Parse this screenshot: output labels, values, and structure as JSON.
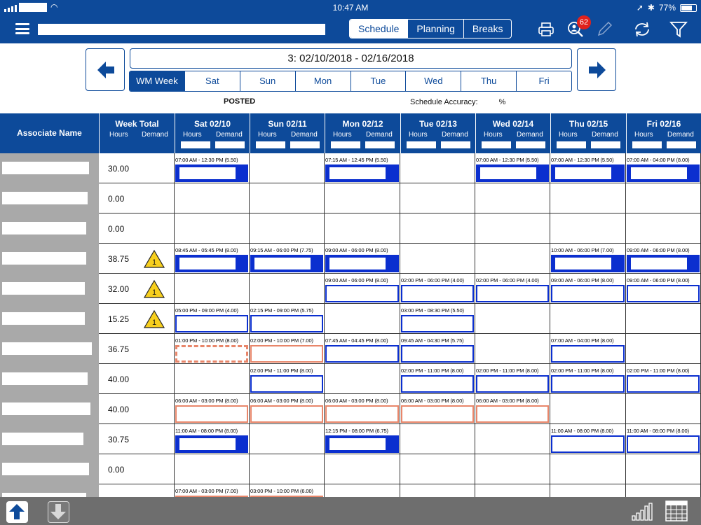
{
  "status": {
    "time": "10:47 AM",
    "battery": "77%",
    "battery_level": 0.77
  },
  "nav": {
    "tabs": [
      "Schedule",
      "Planning",
      "Breaks"
    ],
    "active_tab": "Schedule",
    "notification_count": "62",
    "icons": [
      "print-icon",
      "people-search-icon",
      "pencil-icon",
      "refresh-icon",
      "filter-icon"
    ]
  },
  "week": {
    "range": "3: 02/10/2018 - 02/16/2018",
    "day_tabs": [
      "WM Week",
      "Sat",
      "Sun",
      "Mon",
      "Tue",
      "Wed",
      "Thu",
      "Fri"
    ],
    "posted": "POSTED",
    "accuracy_label": "Schedule Accuracy:",
    "accuracy_unit": "%"
  },
  "grid": {
    "associate_header": "Associate Name",
    "week_total_header": "Week Total",
    "hours_label": "Hours",
    "demand_label": "Demand",
    "days": [
      "Sat 02/10",
      "Sun 02/11",
      "Mon 02/12",
      "Tue 02/13",
      "Wed 02/14",
      "Thu 02/15",
      "Fri 02/16"
    ],
    "rows": [
      {
        "hours": "30.00",
        "warn": false,
        "shifts": [
          "07:00 AM - 12:30 PM (5.50)",
          "",
          "07:15 AM - 12:45 PM (5.50)",
          "",
          "07:00 AM - 12:30 PM (5.50)",
          "07:00 AM - 12:30 PM (5.50)",
          "07:00 AM - 04:00 PM (8.00)"
        ]
      },
      {
        "hours": "0.00",
        "warn": false,
        "shifts": [
          "",
          "",
          "",
          "",
          "",
          "",
          ""
        ]
      },
      {
        "hours": "0.00",
        "warn": false,
        "shifts": [
          "",
          "",
          "",
          "",
          "",
          "",
          ""
        ]
      },
      {
        "hours": "38.75",
        "warn": true,
        "shifts": [
          "08:45 AM - 05:45 PM (8.00)",
          "09:15 AM - 06:00 PM (7.75)",
          "09:00 AM - 06:00 PM (8.00)",
          "",
          "",
          "10:00 AM - 06:00 PM (7.00)",
          "09:00 AM - 06:00 PM (8.00)"
        ]
      },
      {
        "hours": "32.00",
        "warn": true,
        "shifts": [
          "",
          "",
          "09:00 AM - 06:00 PM (8.00)",
          "02:00 PM - 06:00 PM (4.00)",
          "02:00 PM - 06:00 PM (4.00)",
          "09:00 AM - 06:00 PM (8.00)",
          "09:00 AM - 06:00 PM (8.00)"
        ]
      },
      {
        "hours": "15.25",
        "warn": true,
        "shifts": [
          "05:00 PM - 09:00 PM (4.00)",
          "02:15 PM - 09:00 PM (5.75)",
          "",
          "03:00 PM - 08:30 PM (5.50)",
          "",
          "",
          ""
        ]
      },
      {
        "hours": "36.75",
        "warn": false,
        "shifts": [
          "01:00 PM - 10:00 PM (8.00)",
          "02:00 PM - 10:00 PM (7.00)",
          "07:45 AM - 04:45 PM (8.00)",
          "09:45 AM - 04:30 PM (5.75)",
          "",
          "07:00 AM - 04:00 PM (8.00)",
          ""
        ]
      },
      {
        "hours": "40.00",
        "warn": false,
        "shifts": [
          "",
          "02:00 PM - 11:00 PM (8.00)",
          "",
          "02:00 PM - 11:00 PM (8.00)",
          "02:00 PM - 11:00 PM (8.00)",
          "02:00 PM - 11:00 PM (8.00)",
          "02:00 PM - 11:00 PM (8.00)"
        ]
      },
      {
        "hours": "40.00",
        "warn": false,
        "shifts": [
          "06:00 AM - 03:00 PM (8.00)",
          "06:00 AM - 03:00 PM (8.00)",
          "06:00 AM - 03:00 PM (8.00)",
          "06:00 AM - 03:00 PM (8.00)",
          "06:00 AM - 03:00 PM (8.00)",
          "",
          ""
        ]
      },
      {
        "hours": "30.75",
        "warn": false,
        "shifts": [
          "11:00 AM - 08:00 PM (8.00)",
          "",
          "12:15 PM - 08:00 PM (6.75)",
          "",
          "",
          "11:00 AM - 08:00 PM (8.00)",
          "11:00 AM - 08:00 PM (8.00)"
        ]
      },
      {
        "hours": "0.00",
        "warn": false,
        "shifts": [
          "",
          "",
          "",
          "",
          "",
          "",
          ""
        ]
      },
      {
        "hours": "",
        "warn": false,
        "shifts": [
          "07:00 AM - 03:00 PM (7.00)",
          "03:00 PM - 10:00 PM (6.00)",
          "",
          "",
          "",
          "",
          ""
        ]
      }
    ]
  },
  "warning_count": "1",
  "bottom": {
    "icons": [
      "upload-arrow-icon",
      "download-arrow-icon",
      "bar-chart-icon",
      "table-grid-icon"
    ]
  }
}
